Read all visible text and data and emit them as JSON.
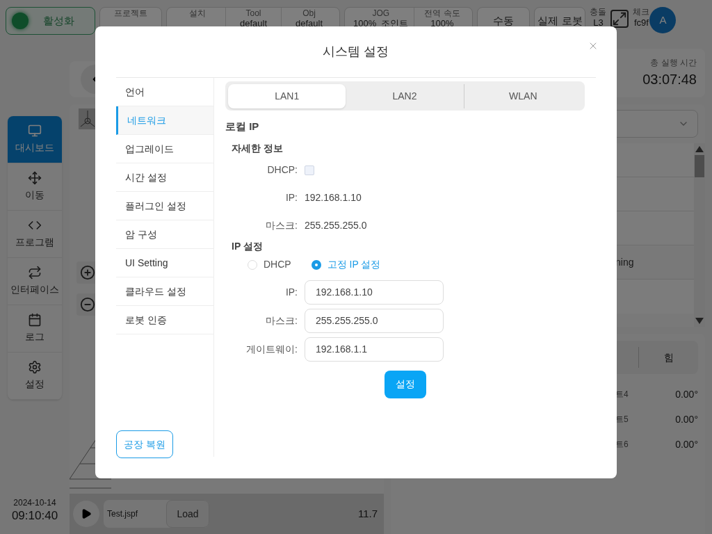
{
  "top_bar": {
    "power_button": {
      "label": "활성화",
      "on": true
    },
    "boxes": [
      {
        "cells": [
          {
            "label": "프로젝트"
          }
        ]
      },
      {
        "cells": [
          {
            "label": "설치"
          },
          {
            "label": "Tool",
            "value": "default"
          },
          {
            "label": "Obj",
            "value": "default"
          }
        ]
      },
      {
        "cells": [
          {
            "label": "JOG",
            "value": "100%  조인트"
          },
          {
            "label": "전역 속도",
            "value": "100%"
          }
        ]
      }
    ],
    "mode_button": "수동",
    "robot_button": "실제 로봇",
    "collision": {
      "label": "충돌",
      "value": "L3"
    },
    "check": {
      "label": "체크",
      "value": "fc9f"
    },
    "avatar": "A"
  },
  "sidebar": {
    "items": [
      {
        "label": "대시보드",
        "selected": true
      },
      {
        "label": "이동",
        "selected": false
      },
      {
        "label": "프로그램",
        "selected": false
      },
      {
        "label": "인터페이스",
        "selected": false
      },
      {
        "label": "로그",
        "selected": false
      },
      {
        "label": "설정",
        "selected": false
      }
    ],
    "date": "2024-10-14",
    "time": "09:10:40"
  },
  "player": {
    "file": "Test.jspf",
    "load_button": "Load",
    "reading": "11.7"
  },
  "runtime": {
    "label": "총 실행 시간",
    "value": "03:07:48"
  },
  "list": {
    "rows": [
      {
        "text": "ning"
      }
    ]
  },
  "joints": {
    "tabs": [
      {
        "label": "힘",
        "selected": false
      }
    ],
    "rows": [
      {
        "label": "트4",
        "value": "0.00°"
      },
      {
        "label": "트5",
        "value": "0.00°"
      },
      {
        "label": "트6",
        "value": "0.00°"
      }
    ]
  },
  "dialog": {
    "title": "시스템 설정",
    "menu": [
      {
        "label": "언어",
        "selected": false
      },
      {
        "label": "네트워크",
        "selected": true
      },
      {
        "label": "업그레이드",
        "selected": false
      },
      {
        "label": "시간 설정",
        "selected": false
      },
      {
        "label": "플러그인 설정",
        "selected": false
      },
      {
        "label": "암 구성",
        "selected": false
      },
      {
        "label": "UI Setting",
        "selected": false
      },
      {
        "label": "클라우드 설정",
        "selected": false
      },
      {
        "label": "로봇 인증",
        "selected": false
      }
    ],
    "factory_reset": "공장 복원",
    "tabs": [
      {
        "label": "LAN1",
        "selected": true
      },
      {
        "label": "LAN2",
        "selected": false
      },
      {
        "label": "WLAN",
        "selected": false
      }
    ],
    "section": "로컬 IP",
    "details": {
      "heading": "자세한 정보",
      "dhcp": {
        "label": "DHCP:",
        "checked": false
      },
      "rows": [
        {
          "label": "IP:",
          "value": "192.168.1.10"
        },
        {
          "label": "마스크:",
          "value": "255.255.255.0"
        }
      ]
    },
    "ip_settings": {
      "heading": "IP 설정",
      "options": [
        {
          "label": "DHCP",
          "selected": false
        },
        {
          "label": "고정 IP 설정",
          "selected": true
        }
      ],
      "fields": [
        {
          "label": "IP:",
          "value": "192.168.1.10"
        },
        {
          "label": "마스크:",
          "value": "255.255.255.0"
        },
        {
          "label": "게이트웨이:",
          "value": "192.168.1.1"
        }
      ],
      "submit": "설정"
    }
  }
}
